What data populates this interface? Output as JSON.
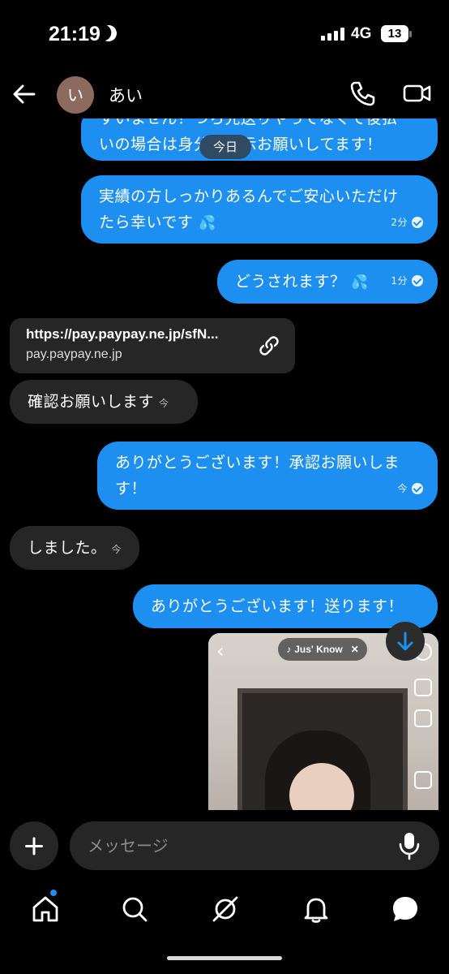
{
  "status": {
    "time": "21:19",
    "network": "4G",
    "battery": "13"
  },
  "header": {
    "avatar_initial": "い",
    "contact_name": "あい"
  },
  "messages": {
    "date_chip": "今日",
    "m1_line1": "すいません！つら先送りやってなくて後払",
    "m1_line2": "いの場合は身分証提示お願いしてます！",
    "m2_line1": "実績の方しっかりあるんでご安心いただけ",
    "m2_line2": "たら幸いです",
    "m2_time": "2分",
    "m3_text": "どうされます？",
    "m3_time": "1分",
    "link_url": "https://pay.paypay.ne.jp/sfN...",
    "link_domain": "pay.paypay.ne.jp",
    "m4_text": "確認お願いします",
    "m4_time": "今",
    "m5_line1": "ありがとうございます！承認お願いしま",
    "m5_line2": "す！",
    "m5_time": "今",
    "m6_text": "しました。",
    "m6_time": "今",
    "m7_text": "ありがとうございます！送ります！",
    "video_music": "Jus' Know"
  },
  "composer": {
    "placeholder": "メッセージ"
  },
  "colors": {
    "outgoing": "#1d8ff0",
    "incoming": "#262626",
    "background": "#000000"
  },
  "tabs": [
    "home-icon",
    "search-icon",
    "explore-icon",
    "bell-icon",
    "messages-icon"
  ]
}
